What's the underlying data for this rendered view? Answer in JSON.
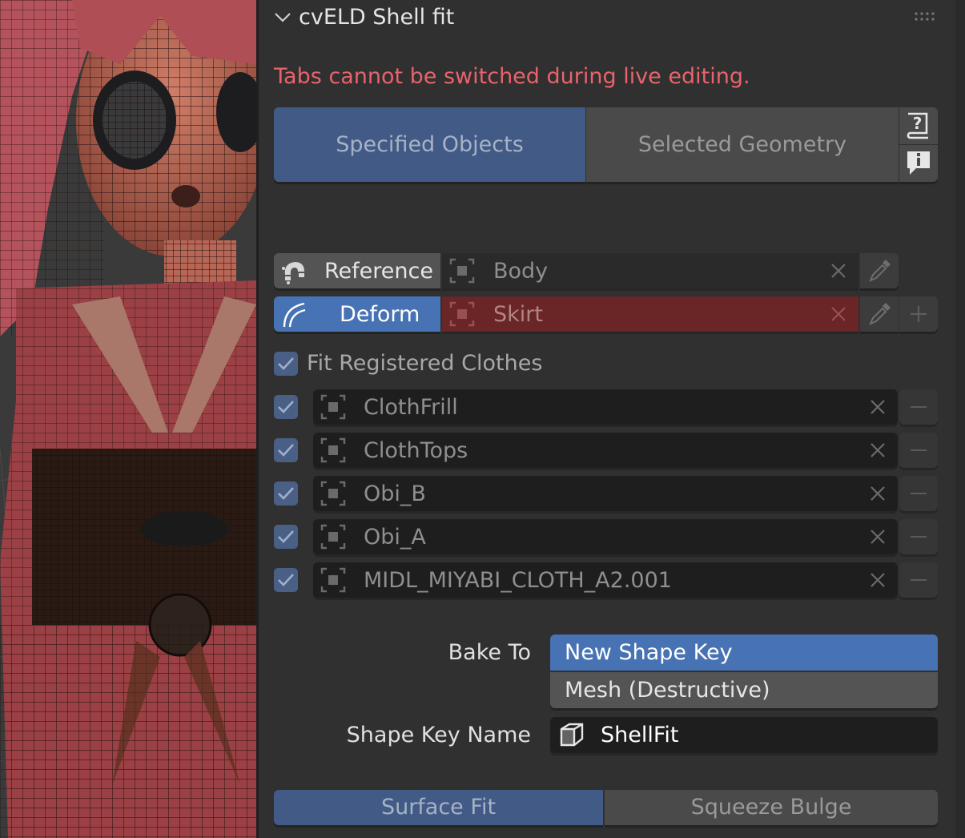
{
  "panel": {
    "title": "cvELD Shell fit",
    "warning": "Tabs cannot be switched during live editing.",
    "warning_color": "#e8636b",
    "tabs": [
      {
        "label": "Specified Objects",
        "active": true
      },
      {
        "label": "Selected Geometry",
        "active": false
      }
    ],
    "help_icons": [
      "help-book-icon",
      "info-bubble-icon"
    ],
    "reference": {
      "label": "Reference",
      "object": "Body",
      "icon": "magnet-icon"
    },
    "deform": {
      "label": "Deform",
      "object": "Skirt",
      "icon": "curve-deform-icon"
    },
    "fit_registered": {
      "label": "Fit Registered Clothes",
      "checked": true
    },
    "clothes": [
      {
        "name": "ClothFrill",
        "checked": true
      },
      {
        "name": "ClothTops",
        "checked": true
      },
      {
        "name": "Obi_B",
        "checked": true
      },
      {
        "name": "Obi_A",
        "checked": true
      },
      {
        "name": "MIDL_MIYABI_CLOTH_A2.001",
        "checked": true
      }
    ],
    "bake_to": {
      "label": "Bake To",
      "options": [
        "New Shape Key",
        "Mesh (Destructive)"
      ],
      "selected": "New Shape Key"
    },
    "shape_key_name": {
      "label": "Shape Key Name",
      "value": "ShellFit"
    },
    "mode_tabs": [
      {
        "label": "Surface Fit",
        "active": true
      },
      {
        "label": "Squeeze Bulge",
        "active": false
      }
    ]
  },
  "colors": {
    "accent_blue": "#4772b3",
    "tab_active": "#415b86",
    "deform_red": "#6a2526",
    "panel_bg": "#303030"
  }
}
